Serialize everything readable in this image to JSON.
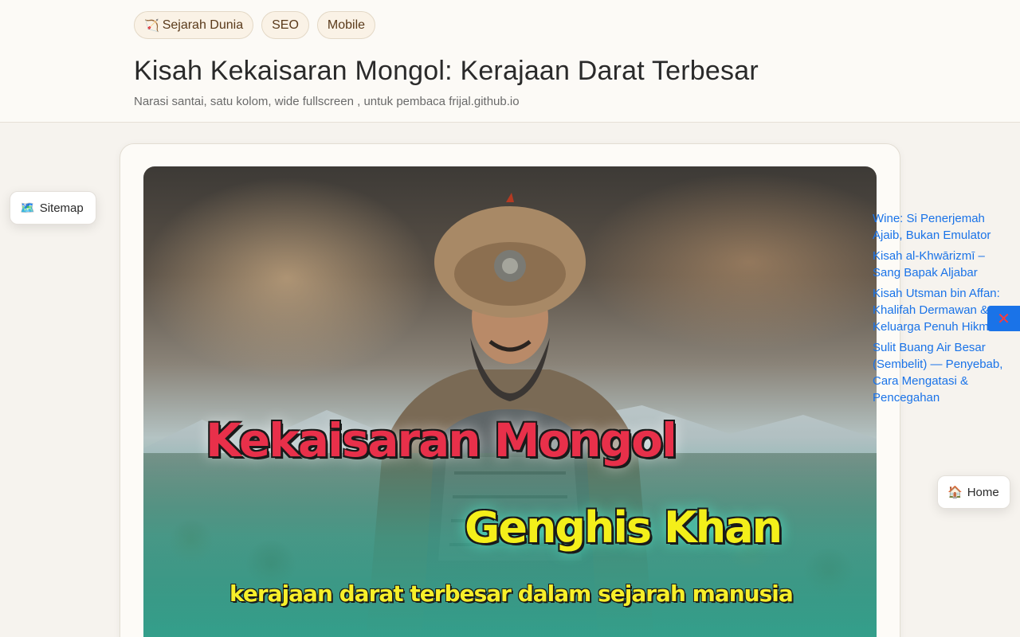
{
  "tags": [
    {
      "icon": "bow-arrow-icon",
      "glyph": "🏹",
      "label": "Sejarah Dunia"
    },
    {
      "label": "SEO"
    },
    {
      "label": "Mobile"
    }
  ],
  "article": {
    "title": "Kisah Kekaisaran Mongol: Kerajaan Darat Terbesar",
    "subtitle": "Narasi santai, satu kolom, wide fullscreen , untuk pembaca frijal.github.io"
  },
  "hero_image": {
    "line1": "Kekaisaran Mongol",
    "line2": "Genghis Khan",
    "line3": "kerajaan darat terbesar dalam sejarah manusia",
    "colors": {
      "line1": "#e8304a",
      "line2": "#f4ef1a",
      "line3": "#f7ef2a"
    }
  },
  "sitemap_button": {
    "icon": "map-icon",
    "glyph": "🗺️",
    "label": "Sitemap"
  },
  "home_button": {
    "icon": "house-icon",
    "glyph": "🏠",
    "label": "Home"
  },
  "related_links": [
    "Wine: Si Penerjemah Ajaib, Bukan Emulator",
    "Kisah al-Khwārizmī – Sang Bapak Aljabar",
    "Kisah Utsman bin Affan: Khalifah Dermawan & Keluarga Penuh Hikmah",
    "Sulit Buang Air Besar (Sembelit) — Penyebab, Cara Mengatasi & Pencegahan"
  ],
  "close_button": {
    "icon": "close-x-icon",
    "glyph": "✕"
  },
  "colors": {
    "link": "#1a73e8",
    "background": "#f6f3ee",
    "tag_bg": "#faf2e6"
  }
}
